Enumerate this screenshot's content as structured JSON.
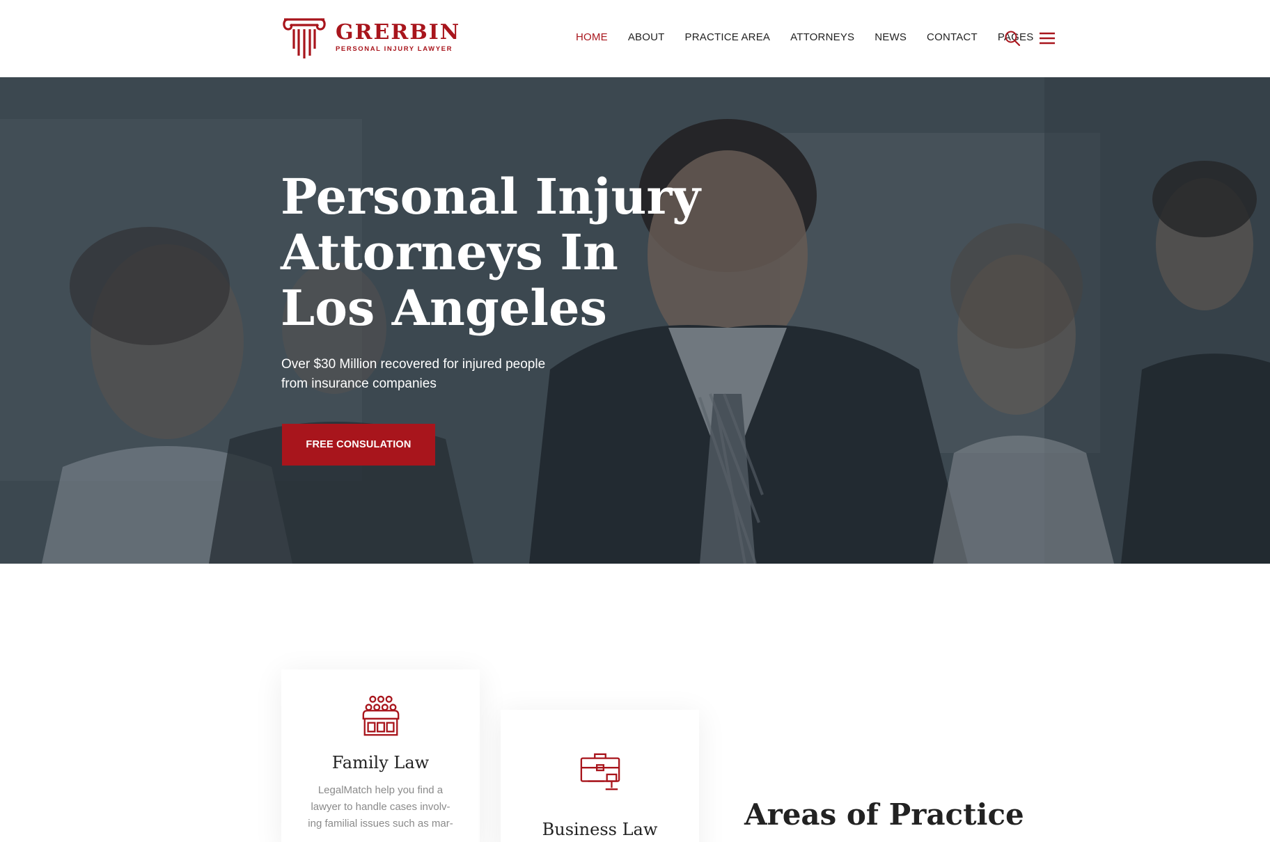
{
  "brand": {
    "name": "GRERBIN",
    "tagline": "PERSONAL INJURY LAWYER",
    "accent_color": "#a8151c"
  },
  "nav": {
    "items": [
      {
        "label": "HOME",
        "active": true
      },
      {
        "label": "ABOUT",
        "active": false
      },
      {
        "label": "PRACTICE AREA",
        "active": false
      },
      {
        "label": "ATTORNEYS",
        "active": false
      },
      {
        "label": "NEWS",
        "active": false
      },
      {
        "label": "CONTACT",
        "active": false
      },
      {
        "label": "PAGES",
        "active": false
      }
    ],
    "icons": [
      "search-icon",
      "hamburger-menu-icon"
    ]
  },
  "hero": {
    "title_line1": "Personal Injury",
    "title_line2": "Attorneys In",
    "title_line3": "Los Angeles",
    "subtitle_line1": "Over $30 Million recovered for injured people",
    "subtitle_line2": "from insurance companies",
    "cta_label": "FREE CONSULATION",
    "background": "photo of smiling business people in office"
  },
  "practice": {
    "section_title": "Areas of Practice",
    "cards": [
      {
        "icon": "jury-box-icon",
        "title": "Family Law",
        "desc_line1": "LegalMatch help you find a",
        "desc_line2": "lawyer to handle cases involv-",
        "desc_line3": "ing familial issues such as mar-"
      },
      {
        "icon": "briefcase-gavel-icon",
        "title": "Business Law"
      }
    ]
  }
}
